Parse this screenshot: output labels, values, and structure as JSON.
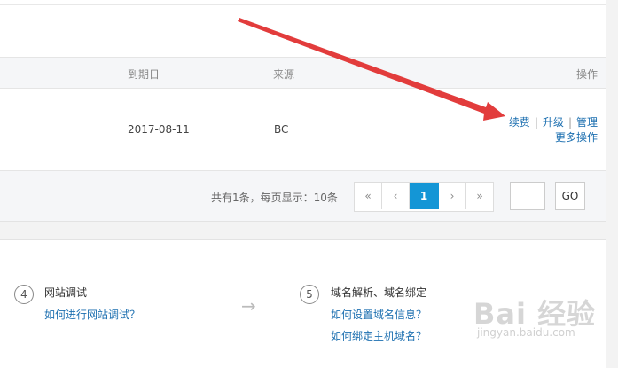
{
  "table": {
    "headers": {
      "expiry": "到期日",
      "source": "来源",
      "ops": "操作"
    },
    "rows": [
      {
        "expiry": "2017-08-11",
        "source": "BC",
        "actions": {
          "renew": "续费",
          "upgrade": "升级",
          "manage": "管理",
          "more": "更多操作"
        },
        "separator": "|"
      }
    ]
  },
  "pagination": {
    "summary": "共有1条，每页显示：10条",
    "first": "«",
    "prev": "‹",
    "current": "1",
    "next": "›",
    "last": "»",
    "go_label": "GO",
    "page_input_value": ""
  },
  "steps": [
    {
      "number": "4",
      "title": "网站调试",
      "links": [
        "如何进行网站调试？"
      ]
    },
    {
      "number": "5",
      "title": "域名解析、域名绑定",
      "links": [
        "如何设置域名信息？",
        "如何绑定主机域名？"
      ]
    }
  ],
  "flow_arrow": "→",
  "watermark": {
    "logo": "Bai 经验",
    "url": "jingyan.baidu.com"
  },
  "colors": {
    "link": "#1c6fb0",
    "accent": "#1496d6",
    "annotation": "#e23c3c"
  }
}
